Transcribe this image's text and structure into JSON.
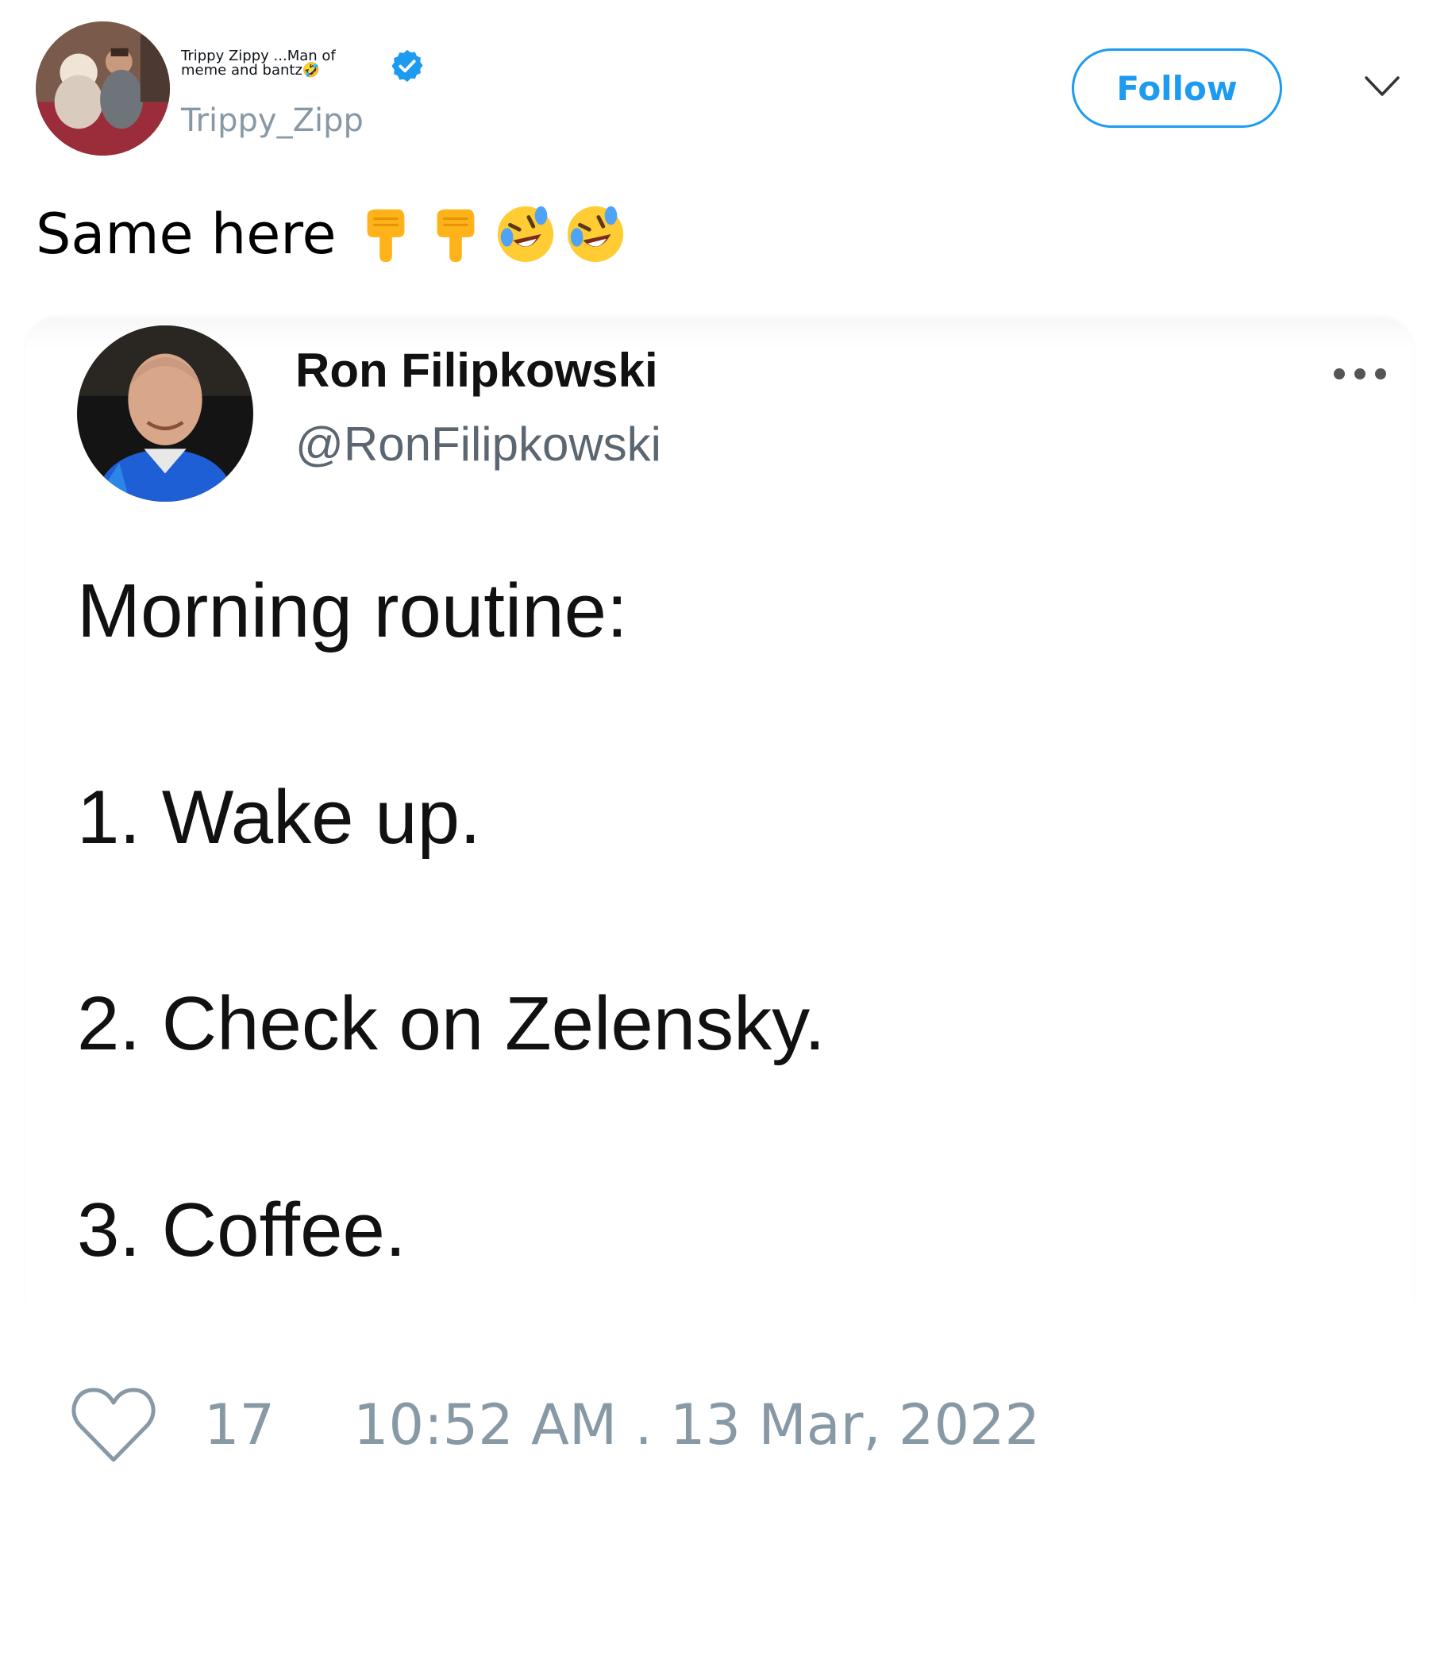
{
  "author": {
    "display_name": "Trippy Zippy ...Man of meme and bantz🤣",
    "handle": "Trippy_Zipp",
    "verified": true
  },
  "follow_label": "Follow",
  "tweet": {
    "text": "Same here",
    "emojis": [
      "backhand-index-pointing-down",
      "backhand-index-pointing-down",
      "rolling-on-the-floor-laughing",
      "rolling-on-the-floor-laughing"
    ]
  },
  "quoted": {
    "name": "Ron Filipkowski",
    "handle": "@RonFilipkowski",
    "lines": [
      "Morning routine:",
      "1. Wake up.",
      "2. Check on Zelensky.",
      "3. Coffee."
    ]
  },
  "footer": {
    "likes": "17",
    "timestamp": "10:52 AM . 13 Mar, 2022"
  },
  "colors": {
    "accent": "#1d9bf0",
    "muted": "#8899a6",
    "text": "#0f1419"
  }
}
